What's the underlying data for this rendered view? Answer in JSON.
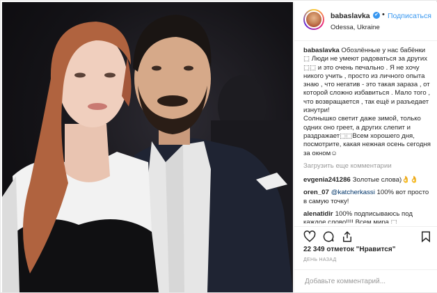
{
  "post": {
    "username": "babaslavka",
    "verified_icon": "✔",
    "separator": "•",
    "follow_label": "Подписаться",
    "location": "Odessa, Ukraine"
  },
  "caption": {
    "username": "babaslavka",
    "text": " Обозлённые у нас бабёнки ⬚ Люди не умеют радоваться за других ⬚⬚ и это очень печально . Я не хочу никого учить , просто из личного опыта знаю , что негатив - это такая зараза , от которой сложно избавиться . Мало того , что возвращается , так ещё и разъедает изнутри!\nСолнышко светит даже зимой, только одних оно греет, а других слепит и раздражает⬚⬚Всем хорошего дня, посмотрите, какая нежная осень сегодня за окном☺"
  },
  "load_more_label": "Загрузить еще комментарии",
  "comments": [
    {
      "username": "evgenia241286",
      "text": "Золотые слова)👌👌"
    },
    {
      "username": "oren_07",
      "mention": "@katcherkassi",
      "text": " 100% вот просто в самую точку!"
    },
    {
      "username": "alenatidir",
      "text": "100% подписываюсь под каждое слово!!!! Всем мира ⬚"
    }
  ],
  "actions": {
    "like_icon": "heart-icon",
    "comment_icon": "comment-icon",
    "share_icon": "share-icon",
    "save_icon": "bookmark-icon"
  },
  "likes_text": "22 349 отметок \"Нравится\"",
  "time_text": "ДЕНЬ НАЗАД",
  "add_comment_placeholder": "Добавьте комментарий..."
}
